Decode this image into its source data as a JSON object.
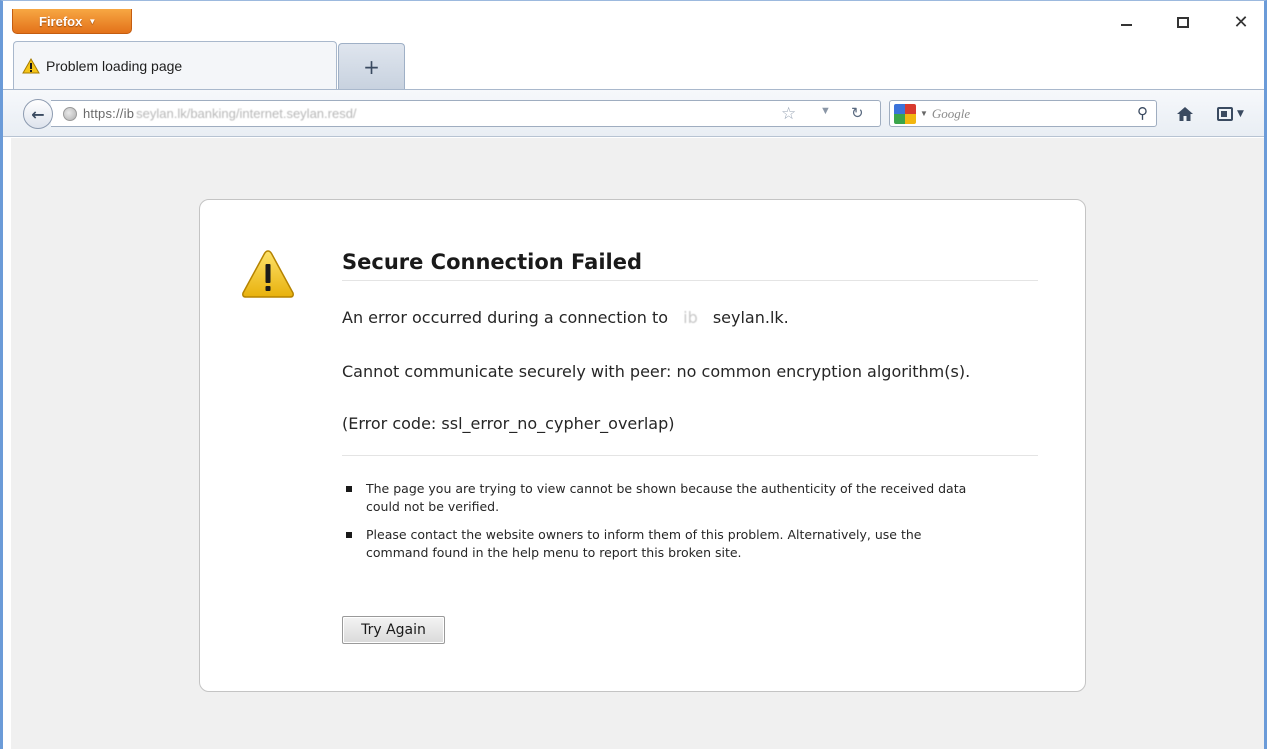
{
  "app": {
    "menu_button_label": "Firefox"
  },
  "tabs": [
    {
      "label": "Problem loading page",
      "icon": "warning-icon"
    }
  ],
  "newtab": {
    "label": "+"
  },
  "navbar": {
    "url_prefix": "https://ib",
    "url_masked": "seylan.lk/banking/internet.seylan.resd/",
    "search_placeholder": "Google"
  },
  "error": {
    "title": "Secure Connection Failed",
    "line1_before": "An error occurred during a connection to",
    "line1_masked": "ib",
    "line1_after": "seylan.lk.",
    "line2": "Cannot communicate securely with peer: no common encryption algorithm(s).",
    "line3": "(Error code: ssl_error_no_cypher_overlap)",
    "bullets": [
      "The page you are trying to view cannot be shown because the authenticity of the received data could not be verified.",
      "Please contact the website owners to inform them of this problem. Alternatively, use the command found in the help menu to report this broken site."
    ],
    "try_again_label": "Try Again"
  },
  "colors": {
    "firefox_button": "#e3721a",
    "window_border": "#6b9bd8",
    "content_bg": "#f0f0f0",
    "warning_yellow": "#f5c518"
  }
}
